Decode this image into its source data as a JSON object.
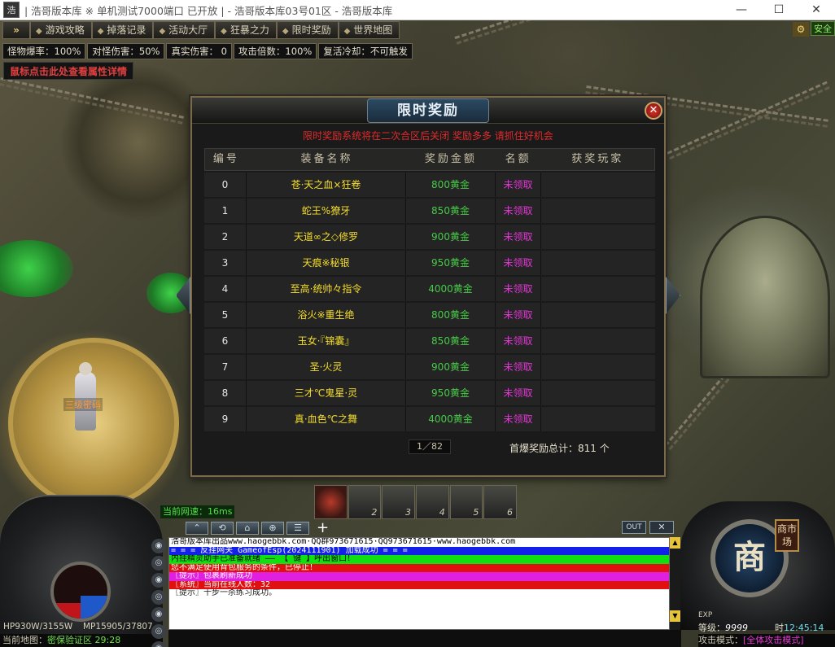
{
  "window": {
    "icon_text": "浩",
    "title": "| 浩哥版本库   ※ 单机测试7000端口 已开放   |  - 浩哥版本库03号01区 - 浩哥版本库",
    "min": "—",
    "max": "☐",
    "close": "✕"
  },
  "menu": {
    "arrow": "»",
    "items": [
      "游戏攻略",
      "掉落记录",
      "活动大厅",
      "狂暴之力",
      "限时奖励",
      "世界地图"
    ],
    "safe": "安全"
  },
  "stats": [
    "怪物爆率：100%",
    "对怪伤害：50%",
    "真实伤害：   0",
    "攻击倍数：100%",
    "复活冷却：不可触发"
  ],
  "hint": "鼠标点击此处查看属性详情",
  "panel": {
    "title": "限时奖励",
    "close": "✕",
    "notice": "限时奖励系统将在二次合区后关闭 奖励多多 请抓住好机会",
    "headers": [
      "编号",
      "装备名称",
      "奖励金额",
      "名额",
      "获奖玩家"
    ],
    "rows": [
      {
        "id": "0",
        "name": "苍·天之血×狂卷",
        "reward": "800黄金",
        "status": "未领取",
        "winner": ""
      },
      {
        "id": "1",
        "name": "蛇王%獠牙",
        "reward": "850黄金",
        "status": "未领取",
        "winner": ""
      },
      {
        "id": "2",
        "name": "天道∞之◇修罗",
        "reward": "900黄金",
        "status": "未领取",
        "winner": ""
      },
      {
        "id": "3",
        "name": "天痕※秘银",
        "reward": "950黄金",
        "status": "未领取",
        "winner": ""
      },
      {
        "id": "4",
        "name": "至高·统帅々指令",
        "reward": "4000黄金",
        "status": "未领取",
        "winner": ""
      },
      {
        "id": "5",
        "name": "浴火※重生绝",
        "reward": "800黄金",
        "status": "未领取",
        "winner": ""
      },
      {
        "id": "6",
        "name": "玉女·『锦囊』",
        "reward": "850黄金",
        "status": "未领取",
        "winner": ""
      },
      {
        "id": "7",
        "name": "圣·火灵",
        "reward": "900黄金",
        "status": "未领取",
        "winner": ""
      },
      {
        "id": "8",
        "name": "三才℃鬼星·灵",
        "reward": "950黄金",
        "status": "未领取",
        "winner": ""
      },
      {
        "id": "9",
        "name": "真·血色℃之舞",
        "reward": "4000黄金",
        "status": "未领取",
        "winner": ""
      }
    ],
    "page": "1／82",
    "total": "首爆奖励总计：811  个"
  },
  "npc": {
    "name": "三级密码"
  },
  "bottom": {
    "net": "当前网速：16ms",
    "skill_slots": [
      "",
      "2",
      "3",
      "4",
      "5",
      "6"
    ],
    "hp": "HP930W/3155W",
    "mp": "MP15905/37807",
    "hp_fraction": 0.29,
    "mp_fraction": 0.42,
    "map_label": "当前地图：",
    "map_value": "密保验证区 29:28",
    "chat_tab_icons": [
      "⌃",
      "⟲",
      "⌂",
      "⊕",
      "☰"
    ],
    "chat_plus": "+",
    "chat_out": "OUT",
    "chat_close": "✕",
    "chat_side_icons": [
      "◉",
      "◎",
      "◉",
      "◎",
      "◉",
      "◎",
      "◉"
    ],
    "chat": [
      {
        "text": "浩哥版本库出品www.haogebbk.com·QQ群973671615·QQ973671615·www.haogebbk.com",
        "bg": "#ffffff",
        "fg": "#000000"
      },
      {
        "text": "= = = 反挂网关 GameofEsp(2024111901) 加载成功 = = =",
        "bg": "#1220e8",
        "fg": "#ffffff"
      },
      {
        "text": "内挂精灵助手已准备就绪 —— 【 键 】呼出窗口！",
        "bg": "#10e010",
        "fg": "#000000"
      },
      {
        "text": "您不满足使用背包服务的条件，已停止！",
        "bg": "#e01010",
        "fg": "#ffffff"
      },
      {
        "text": "〖提示〗包裹刷新成功",
        "bg": "#e020e0",
        "fg": "#ffffff"
      },
      {
        "text": "〖系统〗当前在线人数：32",
        "bg": "#e01010",
        "fg": "#ffffff"
      },
      {
        "text": "〖提示〗十步一杀练习成功。",
        "bg": "#ffffff",
        "fg": "#1a1a1a"
      }
    ],
    "shop": "商",
    "shop_small": "商市场",
    "exp": "EXP",
    "level_label": "等级：",
    "level_value": "9999",
    "clock_label": "时",
    "clock_value": "12:45:14",
    "attack_label": "攻击模式：",
    "attack_value": "[全体攻击模式]"
  }
}
